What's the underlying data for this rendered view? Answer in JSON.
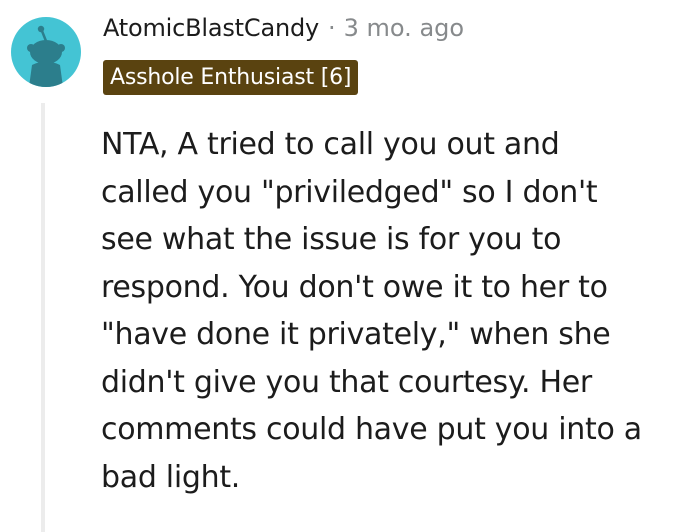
{
  "comment": {
    "author": "AtomicBlastCandy",
    "separator": "·",
    "timestamp": "3 mo. ago",
    "flair": "Asshole Enthusiast [6]",
    "body_lines": [
      "NTA, A tried to call you out and",
      "called you \"priviledged\" so I don't",
      "see what the issue is for you to",
      "respond. You don't owe it to her to",
      "\"have done it privately,\" when she",
      "didn't give you that courtesy. Her",
      "comments could have put you into a",
      "bad light."
    ]
  },
  "icons": {
    "avatar": "reddit-snoo-avatar-icon"
  },
  "colors": {
    "avatar_bg": "#44c4d4",
    "avatar_figure": "#2c7e8c",
    "flair_bg": "#5a4310",
    "flair_text": "#ffffff",
    "username": "#1c1c1c",
    "meta_gray": "#878a8c",
    "thread_line": "#ececec"
  }
}
